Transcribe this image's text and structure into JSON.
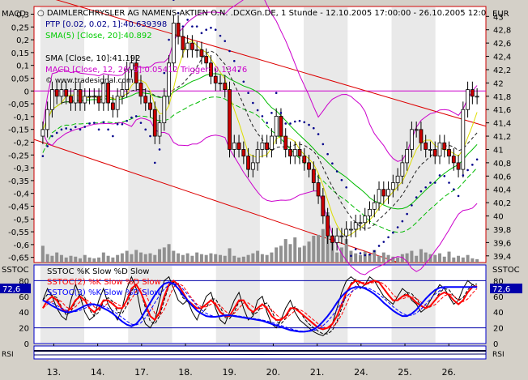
{
  "chart_data": [
    {
      "type": "candlestick",
      "panel": "price",
      "left_axis_label": "MACD",
      "right_axis_label": "EUR",
      "header": "DAIMLERCHRYSLER AG NAMENS-AKTIEN O.N. .DCXGn.DE, 1 Stunde - 12.10.2005 17:00:00 - 26.10.2005 12:0",
      "legend": [
        {
          "text": "PTP [0.02, 0.02, 1]:40.639398",
          "color": "#00008b"
        },
        {
          "text": "SMA(5) [Close, 20]:40.892",
          "color": "#00cc00"
        },
        {
          "text": "SMA [Close, 10]:41.192",
          "color": "#000000"
        },
        {
          "text": "MACD [Close, 12, 26, 9]:0.05412   Trigger: 0.13476",
          "color": "#cc00cc"
        },
        {
          "text": "© www.tradesignal.com",
          "color": "#000000"
        }
      ],
      "right_ticks": [
        "43",
        "42,8",
        "42,6",
        "42,4",
        "42,2",
        "42",
        "41,8",
        "41,6",
        "41,4",
        "41,2",
        "41",
        "40,8",
        "40,6",
        "40,4",
        "40,2",
        "40",
        "39,8",
        "39,6",
        "39,4"
      ],
      "left_ticks": [
        "0,3",
        "0,25",
        "0,2",
        "0,15",
        "0,1",
        "0,05",
        "0",
        "-0,05",
        "-0,1",
        "-0,15",
        "-0,2",
        "-0,25",
        "-0,3",
        "-0,35",
        "-0,4",
        "-0,45",
        "-0,5",
        "-0,55",
        "-0,6",
        "-0,65"
      ],
      "ylim": [
        39.3,
        43.15
      ],
      "macd_lim": [
        -0.67,
        0.33
      ],
      "close": [
        41.3,
        41.6,
        41.9,
        41.8,
        41.9,
        41.8,
        41.7,
        41.9,
        41.7,
        41.8,
        41.8,
        41.8,
        41.7,
        42.0,
        41.7,
        41.6,
        41.8,
        41.9,
        42.2,
        42.3,
        42.0,
        41.8,
        41.7,
        41.6,
        41.2,
        41.4,
        41.8,
        42.3,
        42.9,
        42.7,
        42.5,
        42.6,
        42.5,
        42.5,
        42.4,
        42.3,
        42.1,
        42.0,
        42.0,
        41.9,
        41.0,
        41.1,
        41.0,
        40.9,
        40.7,
        40.8,
        41.0,
        41.1,
        41.0,
        41.2,
        41.5,
        41.2,
        41.0,
        40.9,
        41.0,
        40.9,
        40.8,
        40.7,
        40.5,
        40.3,
        40.0,
        39.7,
        39.6,
        39.7,
        39.7,
        39.8,
        39.8,
        39.9,
        39.9,
        40.0,
        40.1,
        40.2,
        40.4,
        40.3,
        40.4,
        40.5,
        40.6,
        40.8,
        41.0,
        41.3,
        41.3,
        41.1,
        41.0,
        41.0,
        40.9,
        41.1,
        41.0,
        40.9,
        40.8,
        40.7,
        41.6,
        41.9,
        41.8,
        41.8
      ],
      "volume": [
        20,
        10,
        8,
        12,
        9,
        6,
        8,
        7,
        5,
        9,
        6,
        5,
        6,
        12,
        8,
        6,
        9,
        11,
        14,
        10,
        15,
        12,
        10,
        11,
        9,
        16,
        18,
        22,
        14,
        11,
        9,
        11,
        8,
        12,
        10,
        9,
        11,
        10,
        9,
        8,
        17,
        8,
        6,
        7,
        9,
        11,
        14,
        10,
        9,
        12,
        18,
        20,
        28,
        22,
        30,
        18,
        20,
        25,
        32,
        33,
        40,
        60,
        30,
        12,
        18,
        28,
        14,
        11,
        9,
        13,
        10,
        15,
        8,
        12,
        9,
        7,
        6,
        10,
        11,
        14,
        8,
        16,
        12,
        10,
        9,
        11,
        7,
        13,
        6,
        8,
        6,
        9,
        5,
        4
      ],
      "psar_dots_up": [
        36,
        37,
        38,
        39,
        40,
        41,
        42,
        43,
        44,
        45,
        46,
        47,
        48,
        49,
        50,
        51,
        52,
        53,
        54,
        55,
        56,
        57,
        58,
        59,
        60,
        61,
        62
      ],
      "x_ticks": [
        "13.",
        "14.",
        "17.",
        "18.",
        "19.",
        "20.",
        "21.",
        "24.",
        "25.",
        "26."
      ]
    },
    {
      "type": "line",
      "panel": "stochastic",
      "left_axis_label": "SSTOC",
      "right_axis_label": "SSTOC",
      "legend": [
        {
          "text": "SSTOC %K Slow %D Slow",
          "color": "#000000"
        },
        {
          "text": "SSTOC(2) %K Slow %D Slow",
          "color": "#ff0000"
        },
        {
          "text": "SSTOC(3) %K Slow %D Slow",
          "color": "#0000ff"
        }
      ],
      "ticks": [
        "80",
        "72,6",
        "60",
        "40",
        "20",
        "0"
      ],
      "left_badge": "72,6",
      "right_badge": "72,6",
      "ylim": [
        0,
        100
      ],
      "hlines": [
        80,
        20
      ],
      "series": [
        {
          "name": "SSTOC %K Slow",
          "color": "#000000",
          "values": [
            55,
            70,
            60,
            45,
            35,
            30,
            55,
            75,
            60,
            40,
            30,
            35,
            55,
            70,
            50,
            40,
            30,
            45,
            70,
            85,
            70,
            40,
            25,
            20,
            30,
            55,
            80,
            85,
            70,
            55,
            50,
            55,
            40,
            30,
            45,
            60,
            65,
            45,
            30,
            25,
            40,
            55,
            65,
            45,
            30,
            35,
            55,
            60,
            40,
            25,
            20,
            30,
            45,
            55,
            40,
            30,
            25,
            20,
            15,
            12,
            10,
            15,
            25,
            45,
            65,
            80,
            85,
            80,
            70,
            75,
            85,
            80,
            70,
            60,
            55,
            50,
            60,
            70,
            65,
            55,
            50,
            40,
            45,
            55,
            65,
            75,
            70,
            60,
            50,
            55,
            70,
            80,
            75,
            72
          ]
        },
        {
          "name": "SSTOC(2) %K Slow",
          "color": "#ff0000",
          "values": [
            45,
            55,
            60,
            55,
            45,
            40,
            45,
            55,
            60,
            55,
            45,
            40,
            45,
            55,
            55,
            50,
            45,
            45,
            55,
            70,
            75,
            65,
            50,
            35,
            30,
            40,
            60,
            75,
            80,
            75,
            65,
            55,
            50,
            45,
            45,
            50,
            55,
            50,
            40,
            35,
            35,
            45,
            55,
            55,
            45,
            40,
            45,
            50,
            45,
            35,
            30,
            30,
            35,
            45,
            45,
            40,
            35,
            30,
            25,
            20,
            18,
            20,
            25,
            35,
            50,
            65,
            75,
            80,
            78,
            75,
            78,
            80,
            78,
            70,
            62,
            55,
            55,
            60,
            62,
            58,
            52,
            48,
            45,
            48,
            55,
            62,
            65,
            62,
            55,
            50,
            55,
            65,
            72,
            73
          ]
        },
        {
          "name": "SSTOC(3) %K Slow",
          "color": "#0000ff",
          "values": [
            55,
            52,
            48,
            45,
            42,
            40,
            40,
            42,
            45,
            48,
            50,
            50,
            48,
            45,
            42,
            38,
            33,
            28,
            24,
            22,
            25,
            32,
            42,
            52,
            62,
            70,
            76,
            78,
            76,
            70,
            62,
            55,
            48,
            42,
            38,
            35,
            34,
            34,
            35,
            36,
            36,
            35,
            34,
            33,
            32,
            31,
            30,
            29,
            27,
            25,
            23,
            21,
            19,
            17,
            16,
            15,
            15,
            16,
            18,
            22,
            28,
            35,
            43,
            52,
            60,
            66,
            70,
            72,
            72,
            70,
            67,
            63,
            58,
            52,
            47,
            42,
            38,
            35,
            35,
            38,
            43,
            50,
            57,
            63,
            68,
            71,
            72,
            72,
            72,
            72,
            72,
            72,
            72,
            72
          ]
        }
      ],
      "x_ticks": [
        "13.",
        "14.",
        "17.",
        "18.",
        "19.",
        "20.",
        "21.",
        "24.",
        "25.",
        "26."
      ]
    }
  ],
  "bottom_labels": [
    "RSI",
    "RSI"
  ]
}
